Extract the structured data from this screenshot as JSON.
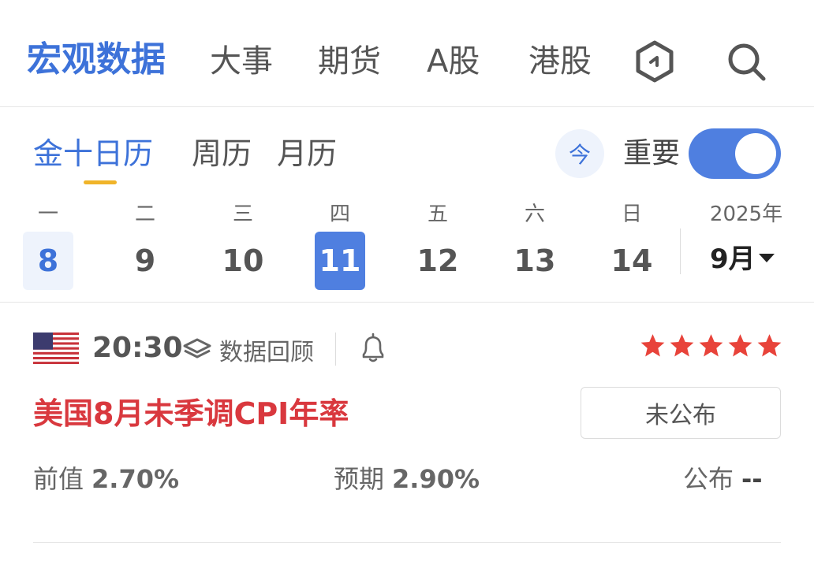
{
  "nav": {
    "tabs": [
      "宏观数据",
      "大事",
      "期货",
      "A股",
      "港股"
    ],
    "active_tab": "宏观数据",
    "icons": [
      "hexagon-icon",
      "search-icon"
    ],
    "accent_color": "#3d72d9"
  },
  "calendar": {
    "tabs": [
      "金十日历",
      "周历",
      "月历"
    ],
    "active_tab": "金十日历",
    "today_label": "今",
    "important_label": "重要",
    "important_toggle_on": true,
    "weekdays": [
      "一",
      "二",
      "三",
      "四",
      "五",
      "六",
      "日"
    ],
    "days": [
      "8",
      "9",
      "10",
      "11",
      "12",
      "13",
      "14"
    ],
    "selected_day": "11",
    "year": "2025年",
    "month": "9月"
  },
  "event": {
    "flag": "us-flag-icon",
    "time": "20:30",
    "review_label": "数据回顾",
    "importance_stars": 5,
    "title": "美国8月未季调CPI年率",
    "status": "未公布",
    "previous_label": "前值",
    "previous_value": "2.70%",
    "forecast_label": "预期",
    "forecast_value": "2.90%",
    "actual_label": "公布",
    "actual_value": "--",
    "title_color": "#d9383e",
    "star_color": "#e8433a"
  }
}
